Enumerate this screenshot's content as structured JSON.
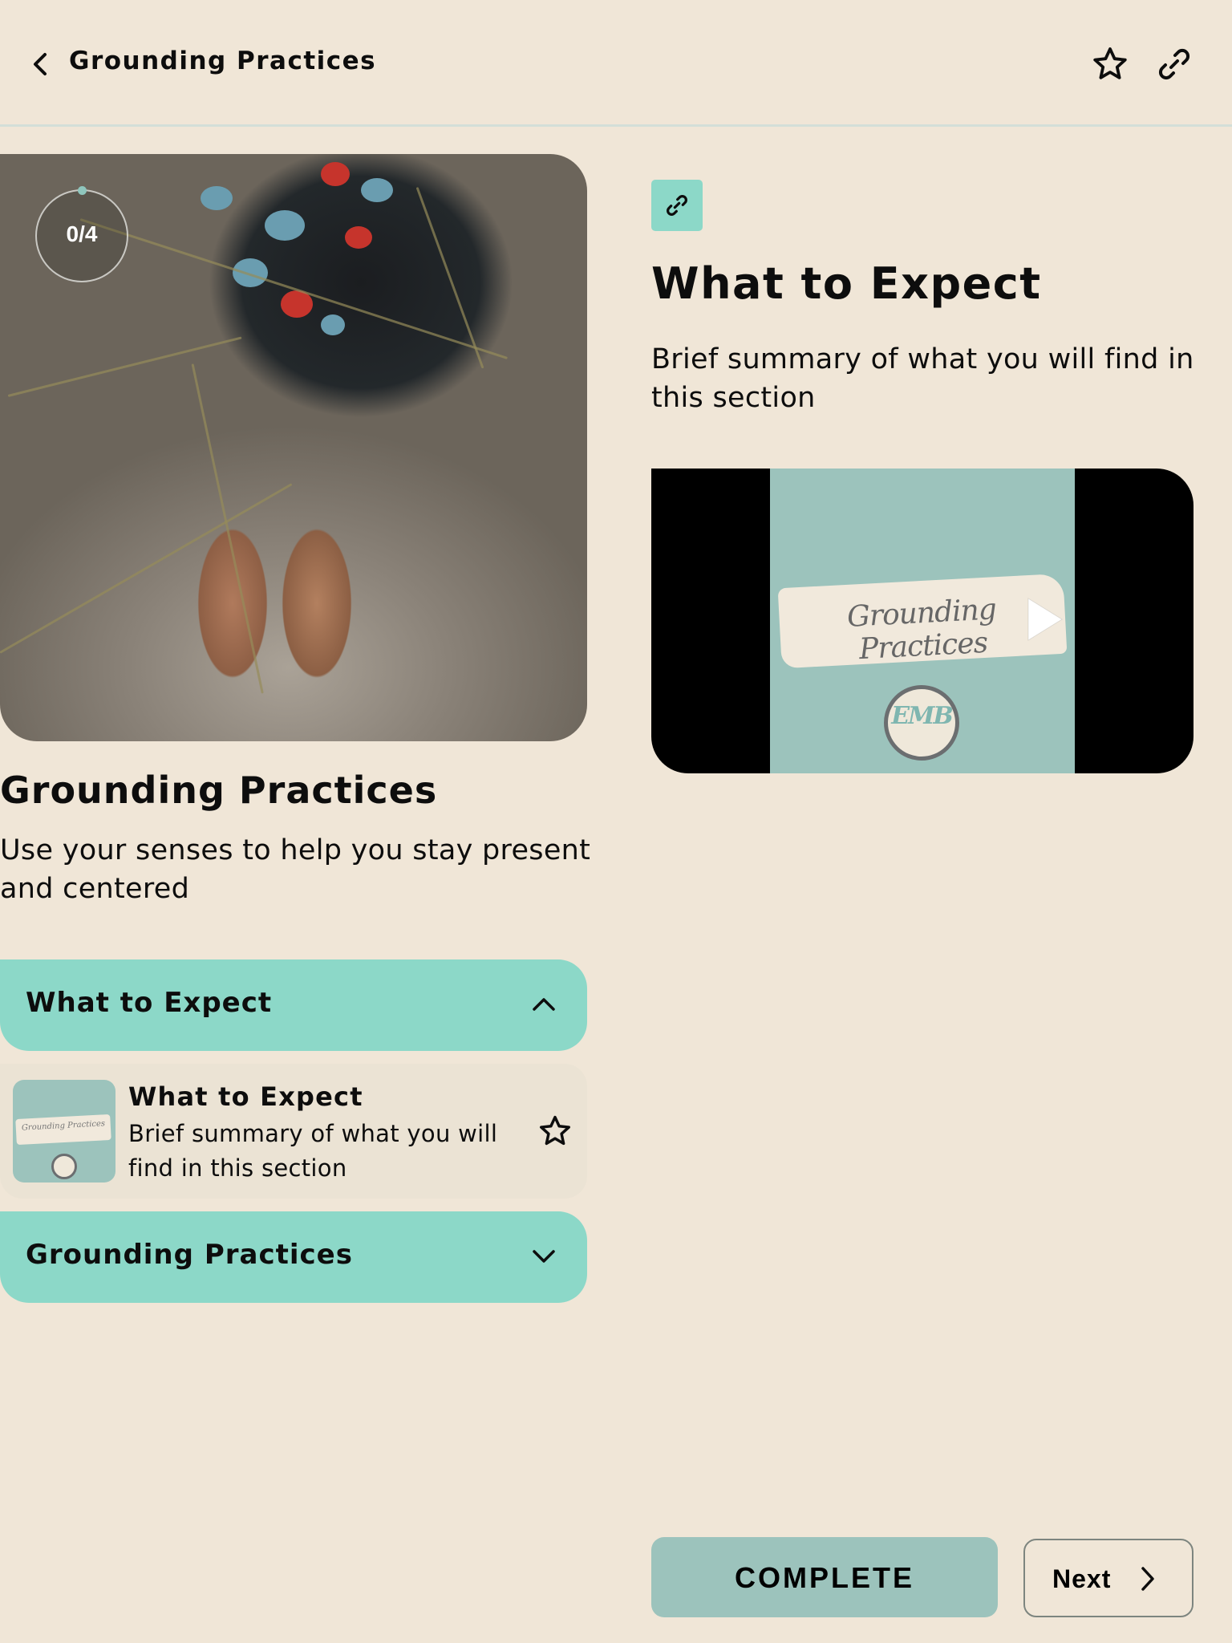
{
  "header": {
    "title": "Grounding Practices",
    "back_icon": "chevron-left-icon",
    "favorite_icon": "star-outline-icon",
    "share_icon": "link-icon"
  },
  "course": {
    "progress_text": "0/4",
    "progress_completed": 0,
    "progress_total": 4,
    "title": "Grounding Practices",
    "description": "Use your senses to help you stay present and centered",
    "hero_image_alt": "Bare feet standing in sand among dune grass"
  },
  "sections": [
    {
      "title": "What to Expect",
      "expanded": true,
      "lessons": [
        {
          "title": "What to Expect",
          "description": "Brief summary of what you will find in this section",
          "thumbnail_text": "Grounding Practices",
          "favorited": false
        }
      ]
    },
    {
      "title": "Grounding Practices",
      "expanded": false,
      "lessons": []
    }
  ],
  "lesson_detail": {
    "type_icon": "link-icon",
    "title": "What to Expect",
    "description": "Brief summary of what you will find in this section",
    "video": {
      "cover_text": "Grounding Practices",
      "logo_text": "EMB"
    }
  },
  "footer": {
    "complete_label": "COMPLETE",
    "next_label": "Next"
  },
  "colors": {
    "background": "#f0e6d7",
    "accent": "#8cd8c8",
    "complete_button": "#9cc3bc",
    "video_cover": "#9cc3bc",
    "text": "#0d0d0d"
  }
}
